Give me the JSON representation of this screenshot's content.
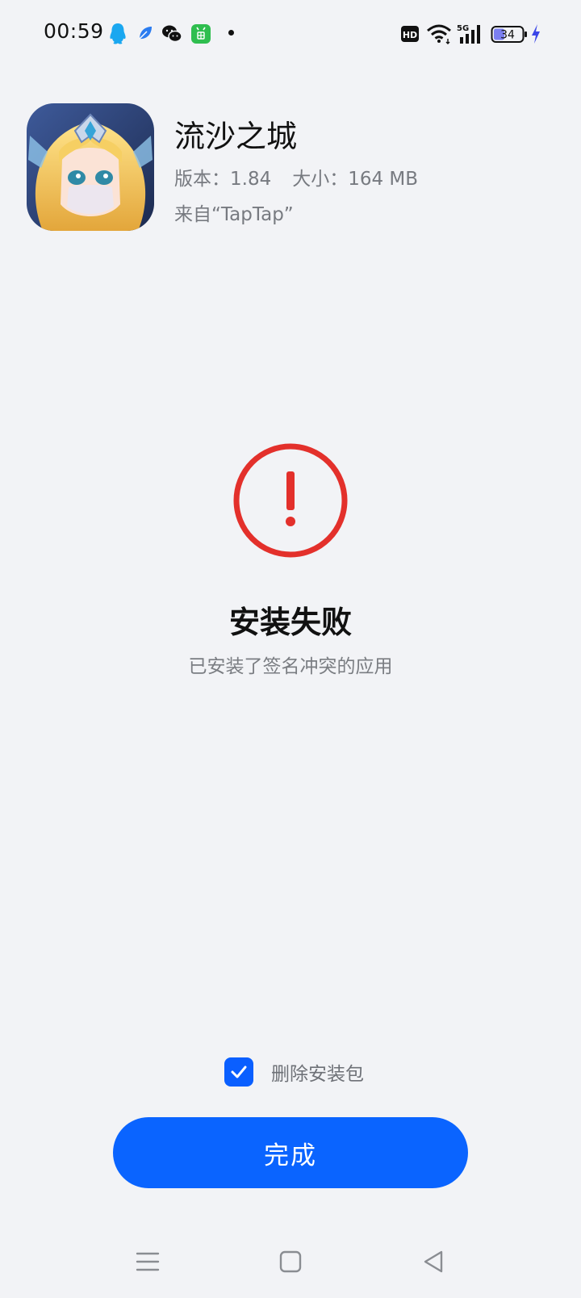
{
  "status_bar": {
    "time": "00:59",
    "notification_icons": [
      "qq-icon",
      "feather-app-icon",
      "wechat-icon",
      "android-app-icon"
    ],
    "right_icons": [
      "hd-icon",
      "wifi-icon",
      "signal-5g-icon",
      "battery-icon",
      "charging-icon"
    ],
    "network_label": "5G",
    "hd_label": "HD",
    "battery_level": "34"
  },
  "app": {
    "name": "流沙之城",
    "version_label": "版本：1.84",
    "size_label": "大小：164 MB",
    "source_label": "来自“TapTap”"
  },
  "result": {
    "title": "安装失败",
    "reason": "已安装了签名冲突的应用"
  },
  "options": {
    "delete_package_label": "删除安装包",
    "delete_package_checked": true
  },
  "actions": {
    "done_label": "完成"
  },
  "nav": {
    "items": [
      "menu-icon",
      "home-icon",
      "back-icon"
    ]
  },
  "colors": {
    "background": "#f2f3f6",
    "accent": "#0a64ff",
    "error": "#e3302b"
  }
}
